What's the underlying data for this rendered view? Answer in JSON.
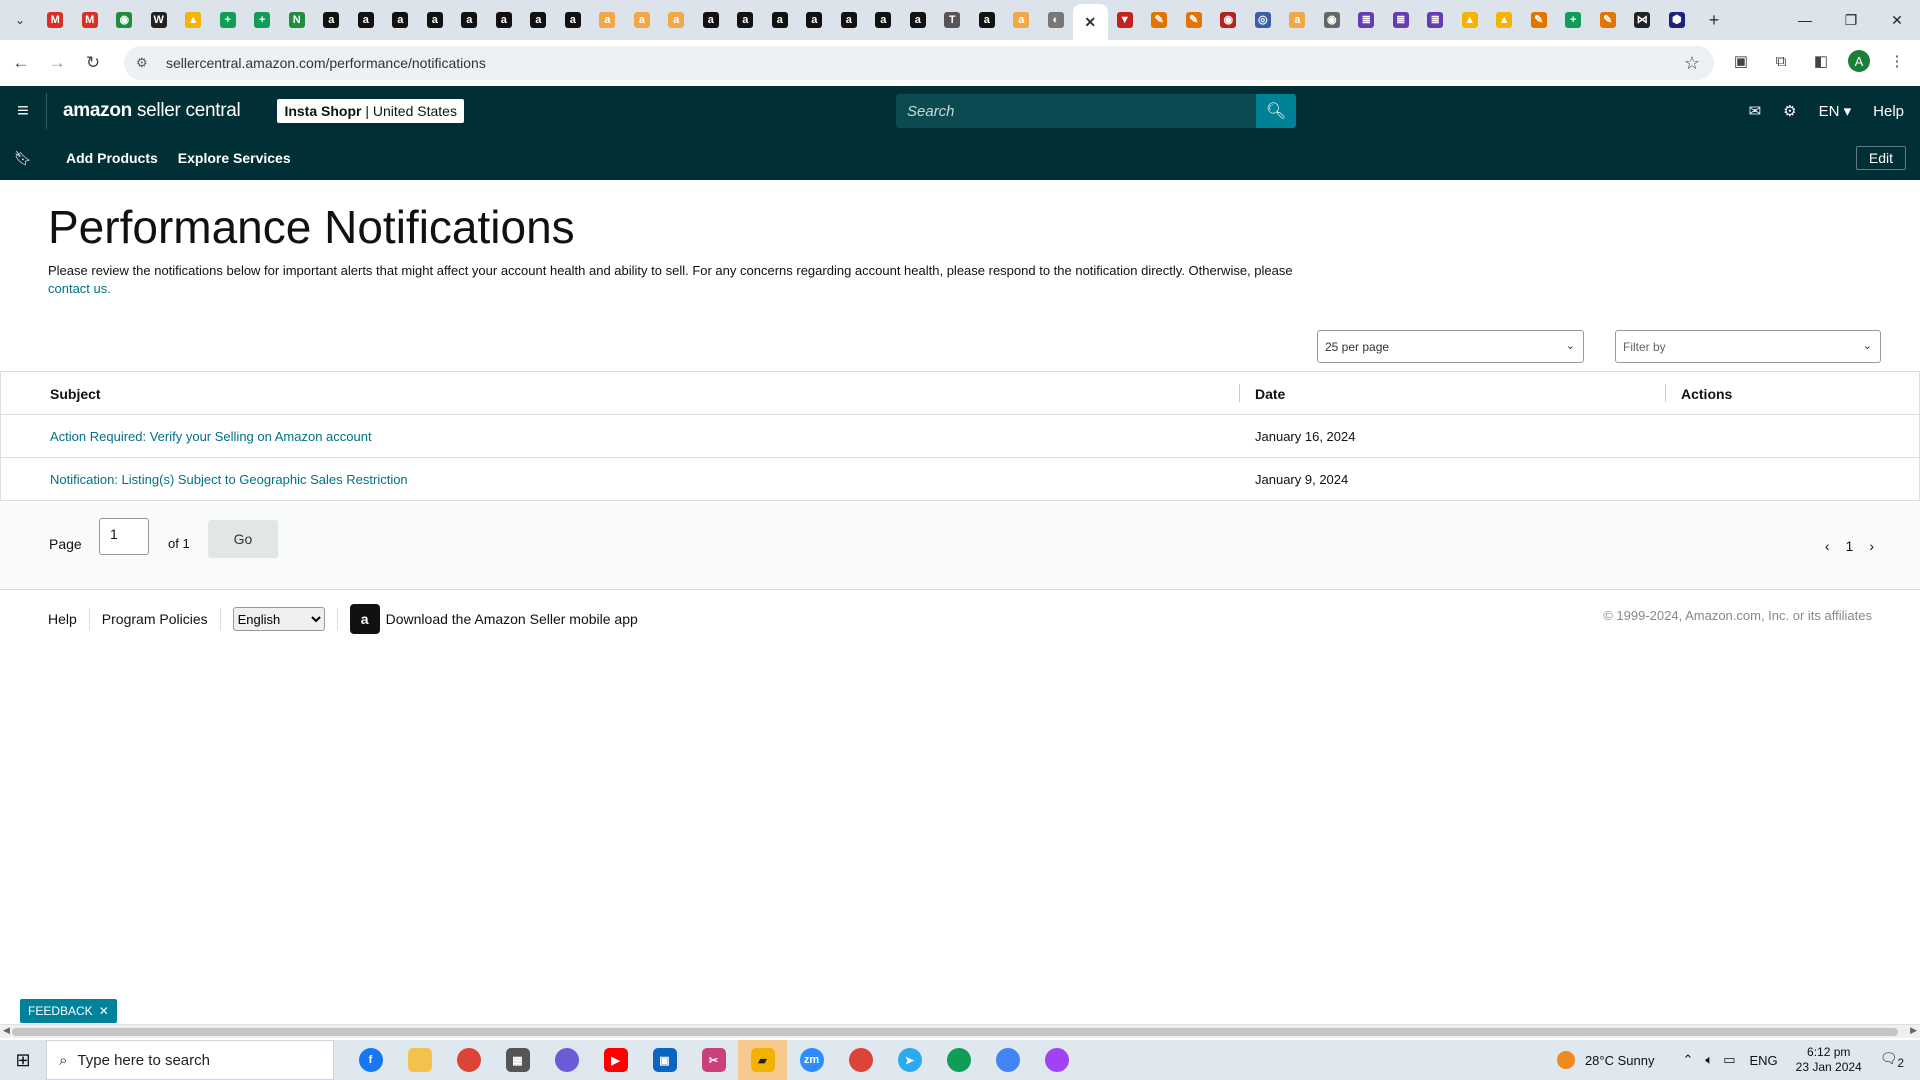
{
  "browser": {
    "url": "sellercentral.amazon.com/performance/notifications",
    "tabs": [
      {
        "icon": "gmail-icon",
        "glyph": "M",
        "color": "#d93025"
      },
      {
        "icon": "gmail-icon",
        "glyph": "M",
        "color": "#d93025"
      },
      {
        "icon": "app-icon",
        "glyph": "◉",
        "color": "#1e8e3e"
      },
      {
        "icon": "wix-icon",
        "glyph": "W",
        "color": "#222222"
      },
      {
        "icon": "drive-icon",
        "glyph": "▲",
        "color": "#f4b400"
      },
      {
        "icon": "sheets-icon",
        "glyph": "+",
        "color": "#0f9d58"
      },
      {
        "icon": "sheets-icon",
        "glyph": "+",
        "color": "#0f9d58"
      },
      {
        "icon": "app-icon",
        "glyph": "N",
        "color": "#1e8e3e"
      },
      {
        "icon": "amazon-icon",
        "glyph": "a",
        "color": "#111111"
      },
      {
        "icon": "amazon-icon",
        "glyph": "a",
        "color": "#111111"
      },
      {
        "icon": "amazon-icon",
        "glyph": "a",
        "color": "#111111"
      },
      {
        "icon": "amazon-icon",
        "glyph": "a",
        "color": "#111111"
      },
      {
        "icon": "amazon-icon",
        "glyph": "a",
        "color": "#111111"
      },
      {
        "icon": "amazon-icon",
        "glyph": "a",
        "color": "#111111"
      },
      {
        "icon": "amazon-icon",
        "glyph": "a",
        "color": "#111111"
      },
      {
        "icon": "amazon-icon",
        "glyph": "a",
        "color": "#111111"
      },
      {
        "icon": "amazon-smile-icon",
        "glyph": "a",
        "color": "#f3a847"
      },
      {
        "icon": "amazon-smile-icon",
        "glyph": "a",
        "color": "#f3a847"
      },
      {
        "icon": "amazon-smile-icon",
        "glyph": "a",
        "color": "#f3a847"
      },
      {
        "icon": "amazon-icon",
        "glyph": "a",
        "color": "#111111"
      },
      {
        "icon": "amazon-icon",
        "glyph": "a",
        "color": "#111111"
      },
      {
        "icon": "amazon-icon",
        "glyph": "a",
        "color": "#111111"
      },
      {
        "icon": "amazon-icon",
        "glyph": "a",
        "color": "#111111"
      },
      {
        "icon": "amazon-icon",
        "glyph": "a",
        "color": "#111111"
      },
      {
        "icon": "amazon-icon",
        "glyph": "a",
        "color": "#111111"
      },
      {
        "icon": "amazon-icon",
        "glyph": "a",
        "color": "#111111"
      },
      {
        "icon": "app-icon",
        "glyph": "T",
        "color": "#555555"
      },
      {
        "icon": "amazon-icon",
        "glyph": "a",
        "color": "#111111"
      },
      {
        "icon": "amazon-smile-icon",
        "glyph": "a",
        "color": "#f3a847"
      },
      {
        "icon": "globe-icon",
        "glyph": "◐",
        "color": "#777777"
      },
      {
        "icon": "close-icon",
        "glyph": "✕",
        "color": "#ffffff",
        "active": true
      },
      {
        "icon": "app-icon",
        "glyph": "▼",
        "color": "#c5221f"
      },
      {
        "icon": "app-icon",
        "glyph": "✎",
        "color": "#e37400"
      },
      {
        "icon": "app-icon",
        "glyph": "✎",
        "color": "#e37400"
      },
      {
        "icon": "app-icon",
        "glyph": "◉",
        "color": "#b3261e"
      },
      {
        "icon": "app-icon",
        "glyph": "◎",
        "color": "#3b5ea8"
      },
      {
        "icon": "amazon-smile-icon",
        "glyph": "a",
        "color": "#f3a847"
      },
      {
        "icon": "app-icon",
        "glyph": "◉",
        "color": "#666666"
      },
      {
        "icon": "forms-icon",
        "glyph": "≣",
        "color": "#673ab7"
      },
      {
        "icon": "forms-icon",
        "glyph": "≣",
        "color": "#673ab7"
      },
      {
        "icon": "forms-icon",
        "glyph": "≣",
        "color": "#673ab7"
      },
      {
        "icon": "drive-icon",
        "glyph": "▲",
        "color": "#f4b400"
      },
      {
        "icon": "drive-icon",
        "glyph": "▲",
        "color": "#f4b400"
      },
      {
        "icon": "app-icon",
        "glyph": "✎",
        "color": "#e37400"
      },
      {
        "icon": "sheets-icon",
        "glyph": "+",
        "color": "#0f9d58"
      },
      {
        "icon": "app-icon",
        "glyph": "✎",
        "color": "#e37400"
      },
      {
        "icon": "app-icon",
        "glyph": "⋈",
        "color": "#222222"
      },
      {
        "icon": "app-icon",
        "glyph": "⬢",
        "color": "#1a237e"
      }
    ]
  },
  "header": {
    "logo_brand": "amazon",
    "logo_product": "seller central",
    "store_name": "Insta Shopr",
    "store_region": "United States",
    "search_placeholder": "Search",
    "language": "EN",
    "help": "Help"
  },
  "nav": {
    "items": [
      "Add Products",
      "Explore Services"
    ],
    "edit": "Edit"
  },
  "page": {
    "title": "Performance Notifications",
    "description": "Please review the notifications below for important alerts that might affect your account health and ability to sell. For any concerns regarding account health, please respond to the notification directly. Otherwise, please",
    "contact_link": "contact us.",
    "per_page": "25 per page",
    "filter_placeholder": "Filter by"
  },
  "table": {
    "columns": [
      "Subject",
      "Date",
      "Actions"
    ],
    "rows": [
      {
        "subject": "Action Required: Verify your Selling on Amazon account",
        "date": "January 16, 2024"
      },
      {
        "subject": "Notification: Listing(s) Subject to Geographic Sales Restriction",
        "date": "January 9, 2024"
      }
    ]
  },
  "pagination": {
    "label": "Page",
    "current": "1",
    "of": "of 1",
    "go": "Go",
    "page_number": "1"
  },
  "footer": {
    "help": "Help",
    "policies": "Program Policies",
    "language": "English",
    "app_text": "Download the Amazon Seller mobile app",
    "copyright": "© 1999-2024, Amazon.com, Inc. or its affiliates"
  },
  "feedback": "FEEDBACK",
  "taskbar": {
    "search_placeholder": "Type here to search",
    "weather": "28°C  Sunny",
    "lang": "ENG",
    "time": "6:12 pm",
    "date": "23 Jan 2024",
    "notifications": "2"
  },
  "colors": {
    "header_bg": "#002f36",
    "link": "#007185",
    "search_button": "#008296"
  }
}
